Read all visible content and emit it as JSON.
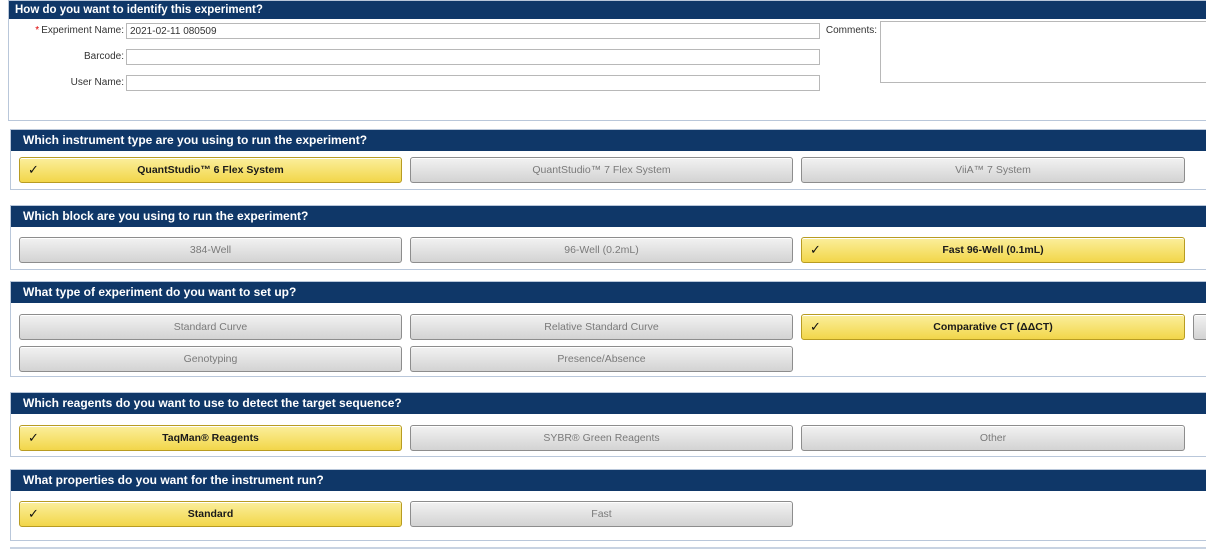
{
  "identify": {
    "header": "How do you want to identify this experiment?",
    "experiment_name_label": "Experiment Name:",
    "required_mark": "*",
    "experiment_name_value": "2021-02-11 080509",
    "barcode_label": "Barcode:",
    "barcode_value": "",
    "user_name_label": "User Name:",
    "user_name_value": "",
    "comments_label": "Comments:",
    "comments_value": ""
  },
  "instrument": {
    "header": "Which instrument type are you using to run the experiment?",
    "options": [
      {
        "label": "QuantStudio™ 6 Flex System",
        "selected": true
      },
      {
        "label": "QuantStudio™ 7 Flex System",
        "selected": false
      },
      {
        "label": "ViiA™ 7 System",
        "selected": false
      }
    ]
  },
  "block": {
    "header": "Which block are you using to run the experiment?",
    "options": [
      {
        "label": "384-Well",
        "selected": false
      },
      {
        "label": "96-Well (0.2mL)",
        "selected": false
      },
      {
        "label": "Fast 96-Well (0.1mL)",
        "selected": true
      }
    ]
  },
  "experiment_type": {
    "header": "What type of experiment do you want to set up?",
    "options": [
      {
        "label": "Standard Curve",
        "selected": false
      },
      {
        "label": "Relative Standard Curve",
        "selected": false
      },
      {
        "label": "Comparative CT (ΔΔCT)",
        "selected": true
      },
      {
        "label": "Genotyping",
        "selected": false
      },
      {
        "label": "Presence/Absence",
        "selected": false
      }
    ]
  },
  "reagents": {
    "header": "Which reagents do you want to use to detect the target sequence?",
    "options": [
      {
        "label": "TaqMan® Reagents",
        "selected": true
      },
      {
        "label": "SYBR® Green Reagents",
        "selected": false
      },
      {
        "label": "Other",
        "selected": false
      }
    ]
  },
  "run_properties": {
    "header": "What properties do you want for the instrument run?",
    "options": [
      {
        "label": "Standard",
        "selected": true
      },
      {
        "label": "Fast",
        "selected": false
      }
    ]
  },
  "check_mark": "✓",
  "colors": {
    "header_bg": "#0f3768",
    "selected_bg": "#f2d64a",
    "unselected_bg": "#d3d3d3"
  }
}
